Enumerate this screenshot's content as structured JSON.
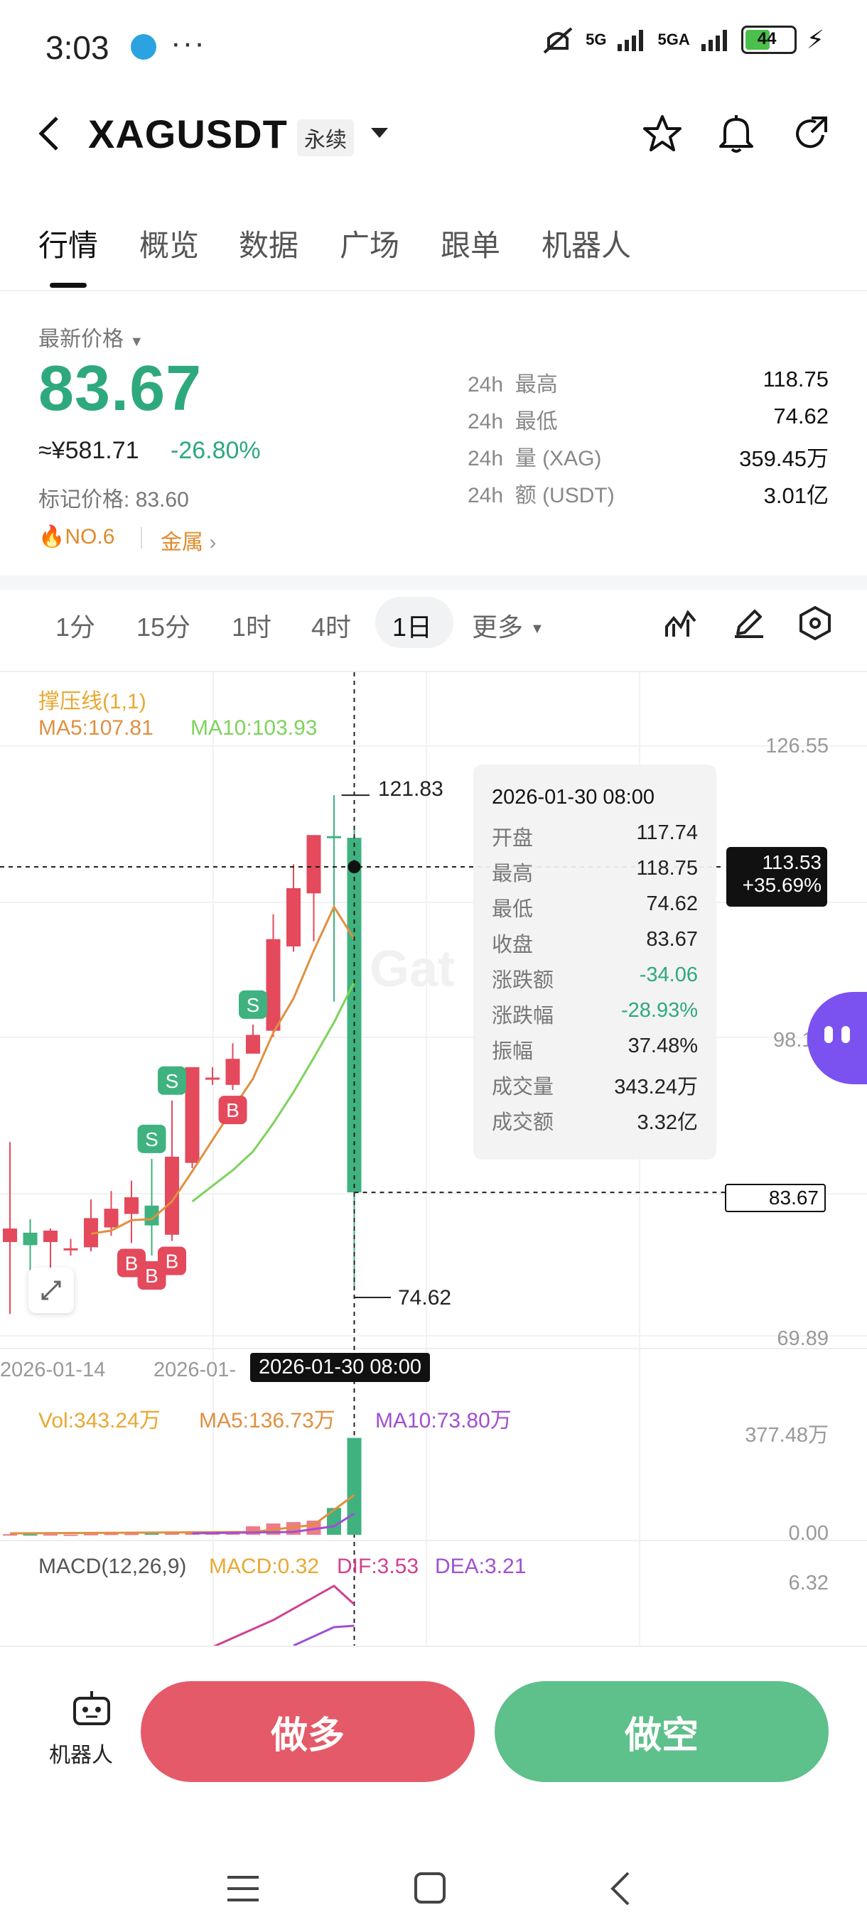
{
  "status": {
    "time": "3:03",
    "more": "···",
    "net1": "5G",
    "net2": "5GA",
    "battery": "44"
  },
  "header": {
    "symbol": "XAGUSDT",
    "contract_type": "永续"
  },
  "tabs": [
    "行情",
    "概览",
    "数据",
    "广场",
    "跟单",
    "机器人"
  ],
  "price": {
    "label": "最新价格",
    "last": "83.67",
    "cny": "≈¥581.71",
    "change": "-26.80%",
    "mark_label": "标记价格:",
    "mark": "83.60",
    "rank": "NO.6",
    "category": "金属"
  },
  "stats": [
    {
      "period": "24h",
      "label": "最高",
      "value": "118.75"
    },
    {
      "period": "24h",
      "label": "最低",
      "value": "74.62"
    },
    {
      "period": "24h",
      "label": "量 (XAG)",
      "value": "359.45万"
    },
    {
      "period": "24h",
      "label": "额 (USDT)",
      "value": "3.01亿"
    }
  ],
  "intervals": [
    "1分",
    "15分",
    "1时",
    "4时",
    "1日",
    "更多"
  ],
  "selected_interval": "1日",
  "indicators": {
    "title": "撑压线(1,1)",
    "ma5": "MA5:107.81",
    "ma10": "MA10:103.93",
    "vol": "Vol:343.24万",
    "vol_ma5": "MA5:136.73万",
    "vol_ma10": "MA10:73.80万",
    "macd_title": "MACD(12,26,9)",
    "macd": "MACD:0.32",
    "dif": "DIF:3.53",
    "dea": "DEA:3.21"
  },
  "axis": {
    "y_top": "126.55",
    "y_mid": "98.1",
    "y_bottom": "69.89",
    "vol_top": "377.48万",
    "vol_bottom": "0.00",
    "macd_top": "6.32",
    "date1": "2026-01-14",
    "date2": "2026-01-",
    "cross_date": "2026-01-30 08:00",
    "high_label": "121.83",
    "low_label": "74.62",
    "cross_price": "113.53",
    "cross_pct": "+35.69%",
    "last_price_tag": "83.67"
  },
  "tooltip": {
    "datetime": "2026-01-30 08:00",
    "rows": [
      {
        "k": "开盘",
        "v": "117.74",
        "color": "#222222"
      },
      {
        "k": "最高",
        "v": "118.75",
        "color": "#222222"
      },
      {
        "k": "最低",
        "v": "74.62",
        "color": "#222222"
      },
      {
        "k": "收盘",
        "v": "83.67",
        "color": "#222222"
      },
      {
        "k": "涨跌额",
        "v": "-34.06",
        "color": "#2ea97d"
      },
      {
        "k": "涨跌幅",
        "v": "-28.93%",
        "color": "#2ea97d"
      },
      {
        "k": "振幅",
        "v": "37.48%",
        "color": "#222222"
      },
      {
        "k": "成交量",
        "v": "343.24万",
        "color": "#222222"
      },
      {
        "k": "成交额",
        "v": "3.32亿",
        "color": "#222222"
      }
    ]
  },
  "chart_data": {
    "type": "candlestick",
    "ylim": [
      69.89,
      126.55
    ],
    "candles": [
      {
        "o": 78.9,
        "h": 88.5,
        "l": 72.0,
        "c": 80.2,
        "vol": 2
      },
      {
        "o": 79.8,
        "h": 81.1,
        "l": 73.5,
        "c": 78.6,
        "vol": 2
      },
      {
        "o": 78.9,
        "h": 80.2,
        "l": 73.8,
        "c": 80.0,
        "vol": 2
      },
      {
        "o": 78.3,
        "h": 79.2,
        "l": 77.6,
        "c": 78.3,
        "vol": 1
      },
      {
        "o": 78.4,
        "h": 83.0,
        "l": 78.0,
        "c": 81.2,
        "vol": 3
      },
      {
        "o": 80.3,
        "h": 83.8,
        "l": 79.5,
        "c": 82.1,
        "vol": 4
      },
      {
        "o": 81.6,
        "h": 84.8,
        "l": 78.8,
        "c": 83.2,
        "vol": 4
      },
      {
        "o": 82.4,
        "h": 86.9,
        "l": 77.6,
        "c": 80.5,
        "vol": 5
      },
      {
        "o": 79.6,
        "h": 92.5,
        "l": 79.0,
        "c": 87.1,
        "vol": 6
      },
      {
        "o": 86.5,
        "h": 95.7,
        "l": 86.0,
        "c": 95.7,
        "vol": 8
      },
      {
        "o": 94.7,
        "h": 95.7,
        "l": 94.0,
        "c": 94.7,
        "vol": 8
      },
      {
        "o": 94.0,
        "h": 98.0,
        "l": 93.5,
        "c": 96.5,
        "vol": 10
      },
      {
        "o": 97.0,
        "h": 99.8,
        "l": 97.0,
        "c": 98.8,
        "vol": 30
      },
      {
        "o": 99.2,
        "h": 110.4,
        "l": 98.6,
        "c": 108.0,
        "vol": 40
      },
      {
        "o": 107.3,
        "h": 115.2,
        "l": 106.8,
        "c": 112.9,
        "vol": 45
      },
      {
        "o": 112.4,
        "h": 118.0,
        "l": 107.8,
        "c": 118.0,
        "vol": 50
      },
      {
        "o": 117.9,
        "h": 121.83,
        "l": 102.0,
        "c": 117.7,
        "vol": 95
      },
      {
        "o": 117.74,
        "h": 118.75,
        "l": 74.62,
        "c": 83.67,
        "vol": 343.24
      }
    ],
    "ma5": [
      null,
      null,
      null,
      null,
      79.7,
      80.0,
      81.0,
      81.1,
      82.8,
      85.7,
      88.7,
      91.7,
      94.6,
      99.0,
      102.3,
      106.9,
      111.1,
      108.0
    ],
    "ma10": [
      null,
      null,
      null,
      null,
      null,
      null,
      null,
      null,
      null,
      82.8,
      84.3,
      85.8,
      87.6,
      90.3,
      93.3,
      96.6,
      100.0,
      103.9
    ],
    "signals": [
      {
        "i": 6,
        "type": "B"
      },
      {
        "i": 7,
        "type": "B"
      },
      {
        "i": 8,
        "type": "B"
      },
      {
        "i": 7,
        "type": "S"
      },
      {
        "i": 8,
        "type": "S"
      },
      {
        "i": 11,
        "type": "B"
      },
      {
        "i": 12,
        "type": "S"
      }
    ]
  },
  "actions": {
    "robot": "机器人",
    "long": "做多",
    "short": "做空"
  }
}
